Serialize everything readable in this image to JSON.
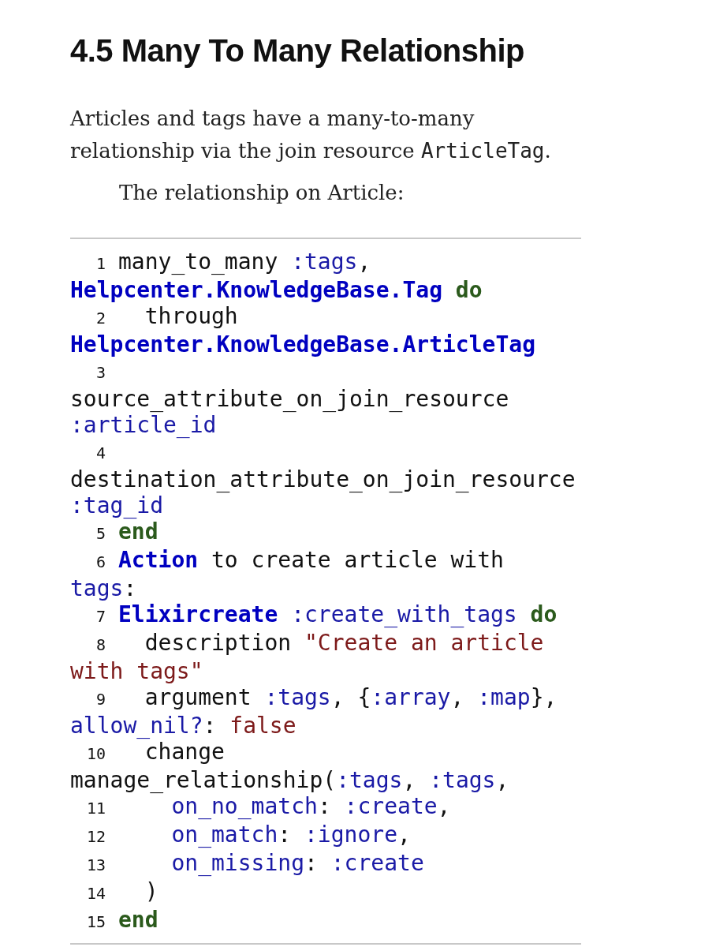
{
  "heading": "4.5 Many To Many Relationship",
  "paragraphs": [
    {
      "indent": false,
      "parts": [
        {
          "kind": "text",
          "text": "Articles and tags have a many-to-many relationship via the join resource "
        },
        {
          "kind": "code",
          "text": "ArticleTag"
        },
        {
          "kind": "text",
          "text": "."
        }
      ]
    },
    {
      "indent": true,
      "parts": [
        {
          "kind": "text",
          "text": "The relationship on Article:"
        }
      ]
    }
  ],
  "code_lines": [
    {
      "number": "1",
      "tokens": [
        {
          "kind": "plain",
          "text": "many_to_many "
        },
        {
          "kind": "atom",
          "text": ":tags"
        },
        {
          "kind": "plain",
          "text": ", "
        },
        {
          "kind": "module",
          "text": "Helpcenter.KnowledgeBase.Tag"
        },
        {
          "kind": "keyword",
          "text": " do"
        }
      ]
    },
    {
      "number": "2",
      "tokens": [
        {
          "kind": "plain",
          "text": "  through "
        },
        {
          "kind": "module",
          "text": "Helpcenter.KnowledgeBase.ArticleTag"
        }
      ]
    },
    {
      "number": "3",
      "tokens": [
        {
          "kind": "plain",
          "text": "  source_attribute_on_join_resource "
        },
        {
          "kind": "atom",
          "text": ":article_id"
        }
      ]
    },
    {
      "number": "4",
      "tokens": [
        {
          "kind": "plain",
          "text": "  destination_attribute_on_join_resource "
        },
        {
          "kind": "atom",
          "text": ":tag_id"
        }
      ]
    },
    {
      "number": "5",
      "tokens": [
        {
          "kind": "keyword",
          "text": "end"
        }
      ]
    },
    {
      "number": "6",
      "tokens": [
        {
          "kind": "module",
          "text": "Action"
        },
        {
          "kind": "plain",
          "text": " to create article with "
        },
        {
          "kind": "atom",
          "text": "tags"
        },
        {
          "kind": "plain",
          "text": ":"
        }
      ]
    },
    {
      "number": "7",
      "tokens": [
        {
          "kind": "module",
          "text": "Elixircreate"
        },
        {
          "kind": "atom",
          "text": " :create_with_tags"
        },
        {
          "kind": "keyword",
          "text": " do"
        }
      ]
    },
    {
      "number": "8",
      "tokens": [
        {
          "kind": "plain",
          "text": "  description "
        },
        {
          "kind": "string",
          "text": "\"Create an article with tags\""
        }
      ]
    },
    {
      "number": "9",
      "tokens": [
        {
          "kind": "plain",
          "text": "  argument "
        },
        {
          "kind": "atom",
          "text": ":tags"
        },
        {
          "kind": "plain",
          "text": ", {"
        },
        {
          "kind": "atom",
          "text": ":array"
        },
        {
          "kind": "plain",
          "text": ", "
        },
        {
          "kind": "atom",
          "text": ":map"
        },
        {
          "kind": "plain",
          "text": "}, "
        },
        {
          "kind": "atom",
          "text": "allow_nil?"
        },
        {
          "kind": "plain",
          "text": ": "
        },
        {
          "kind": "string",
          "text": "false"
        }
      ]
    },
    {
      "number": "10",
      "tokens": [
        {
          "kind": "plain",
          "text": "  change manage_relationship("
        },
        {
          "kind": "atom",
          "text": ":tags"
        },
        {
          "kind": "plain",
          "text": ", "
        },
        {
          "kind": "atom",
          "text": ":tags"
        },
        {
          "kind": "plain",
          "text": ","
        }
      ]
    },
    {
      "number": "11",
      "tokens": [
        {
          "kind": "atom",
          "text": "    on_no_match"
        },
        {
          "kind": "plain",
          "text": ": "
        },
        {
          "kind": "atom",
          "text": ":create"
        },
        {
          "kind": "plain",
          "text": ","
        }
      ]
    },
    {
      "number": "12",
      "tokens": [
        {
          "kind": "atom",
          "text": "    on_match"
        },
        {
          "kind": "plain",
          "text": ": "
        },
        {
          "kind": "atom",
          "text": ":ignore"
        },
        {
          "kind": "plain",
          "text": ","
        }
      ]
    },
    {
      "number": "13",
      "tokens": [
        {
          "kind": "atom",
          "text": "    on_missing"
        },
        {
          "kind": "plain",
          "text": ": "
        },
        {
          "kind": "atom",
          "text": ":create"
        }
      ]
    },
    {
      "number": "14",
      "tokens": [
        {
          "kind": "plain",
          "text": "  )"
        }
      ]
    },
    {
      "number": "15",
      "tokens": [
        {
          "kind": "keyword",
          "text": "end"
        }
      ]
    }
  ]
}
